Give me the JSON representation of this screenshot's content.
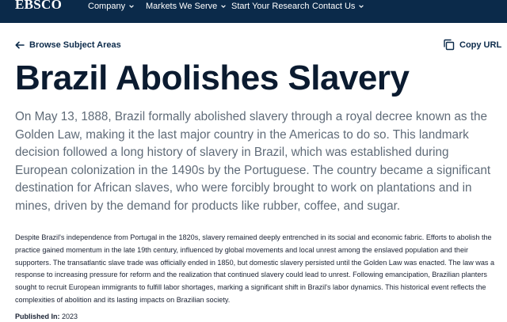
{
  "header": {
    "logo": "EBSCO",
    "nav": [
      {
        "label": "Company",
        "has_dropdown": true
      },
      {
        "label": "Markets We Serve",
        "has_dropdown": true
      },
      {
        "label": "Start Your Research",
        "has_dropdown": false
      },
      {
        "label": "Contact Us",
        "has_dropdown": true
      }
    ]
  },
  "toolbar": {
    "back_label": "Browse Subject Areas",
    "back_icon": "arrow-left-icon",
    "copy_label": "Copy URL",
    "copy_icon": "copy-icon"
  },
  "article": {
    "title": "Brazil Abolishes Slavery",
    "lead": "On May 13, 1888, Brazil formally abolished slavery through a royal decree known as the Golden Law, making it the last major country in the Americas to do so. This landmark decision followed a long history of slavery in Brazil, which was established during European colonization in the 1490s by the Portuguese. The country became a significant destination for African slaves, who were forcibly brought to work on plantations and in mines, driven by the demand for products like rubber, coffee, and sugar.",
    "body": "Despite Brazil's independence from Portugal in the 1820s, slavery remained deeply entrenched in its social and economic fabric. Efforts to abolish the practice gained momentum in the late 19th century, influenced by global movements and local unrest among the enslaved population and their supporters. The transatlantic slave trade was officially ended in 1850, but domestic slavery persisted until the Golden Law was enacted. The law was a response to increasing pressure for reform and the realization that continued slavery could lead to unrest. Following emancipation, Brazilian planters sought to recruit European immigrants to fulfill labor shortages, marking a significant shift in Brazil's labor dynamics. This historical event reflects the complexities of abolition and its lasting impacts on Brazilian society.",
    "published_label": "Published In:",
    "published_value": "2023"
  },
  "colors": {
    "nav_bg": "#0b2a4a",
    "title": "#0b1b30",
    "lead_text": "#5f6b78",
    "body_text": "#1a2233"
  }
}
